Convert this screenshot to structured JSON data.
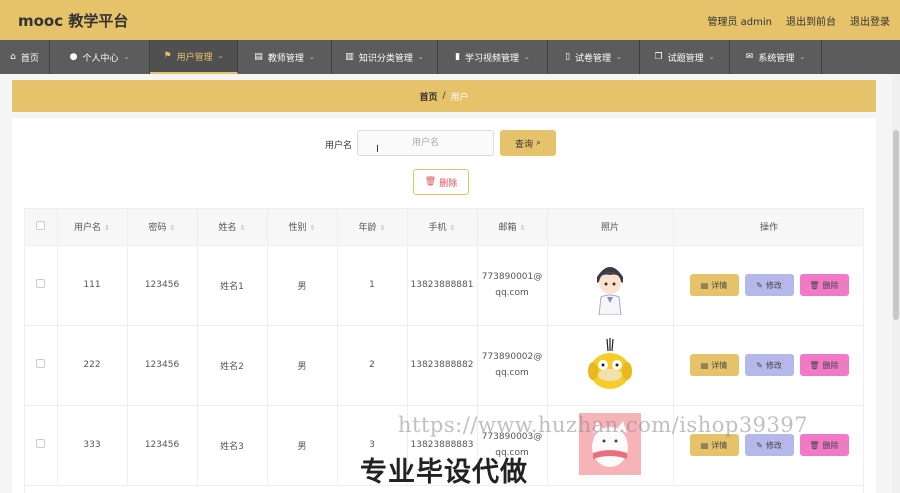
{
  "header": {
    "logo": "mooc 教学平台",
    "admin_label": "管理员 admin",
    "back_front": "退出到前台",
    "logout": "退出登录"
  },
  "nav": [
    {
      "label": "首页",
      "icon": "home-icon",
      "glyph": "⌂",
      "has_caret": false
    },
    {
      "label": "个人中心",
      "icon": "person-icon",
      "glyph": "●",
      "has_caret": true
    },
    {
      "label": "用户管理",
      "icon": "flag-icon",
      "glyph": "⚑",
      "has_caret": true,
      "active": true
    },
    {
      "label": "教师管理",
      "icon": "database-icon",
      "glyph": "▤",
      "has_caret": true
    },
    {
      "label": "知识分类管理",
      "icon": "columns-icon",
      "glyph": "▥",
      "has_caret": true
    },
    {
      "label": "学习视频管理",
      "icon": "bar-chart-icon",
      "glyph": "▮",
      "has_caret": true
    },
    {
      "label": "试卷管理",
      "icon": "mobile-icon",
      "glyph": "▯",
      "has_caret": true
    },
    {
      "label": "试题管理",
      "icon": "copy-icon",
      "glyph": "❐",
      "has_caret": true
    },
    {
      "label": "系统管理",
      "icon": "envelope-icon",
      "glyph": "✉",
      "has_caret": true
    }
  ],
  "breadcrumb": {
    "home": "首页",
    "sep": "/",
    "current": "用户"
  },
  "search": {
    "label": "用户名",
    "placeholder": "用户名",
    "value": "",
    "button": "查询",
    "delete_button": "删除"
  },
  "table": {
    "columns": [
      "用户名",
      "密码",
      "姓名",
      "性别",
      "年龄",
      "手机",
      "邮箱",
      "照片",
      "操作"
    ],
    "sortable": [
      true,
      true,
      true,
      true,
      true,
      true,
      true,
      false,
      false
    ],
    "rows": [
      {
        "username": "111",
        "password": "123456",
        "name": "姓名1",
        "gender": "男",
        "age": "1",
        "phone": "13823888881",
        "email_1": "773890001@",
        "email_2": "qq.com",
        "photo": "boy-avatar"
      },
      {
        "username": "222",
        "password": "123456",
        "name": "姓名2",
        "gender": "男",
        "age": "2",
        "phone": "13823888882",
        "email_1": "773890002@",
        "email_2": "qq.com",
        "photo": "psyduck-avatar"
      },
      {
        "username": "333",
        "password": "123456",
        "name": "姓名3",
        "gender": "男",
        "age": "3",
        "phone": "13823888883",
        "email_1": "773890003@",
        "email_2": "qq.com",
        "photo": "cat-avatar"
      }
    ],
    "ops": {
      "detail": "详情",
      "edit": "修改",
      "delete": "删除"
    }
  },
  "watermark": {
    "url": "https://www.huzhan.com/ishop39397",
    "text": "专业毕设代做"
  },
  "colors": {
    "accent": "#e6c36a",
    "nav_bg": "#5c5c5c",
    "edit_btn": "#b4b8ea",
    "delete_btn": "#f07ac6"
  }
}
